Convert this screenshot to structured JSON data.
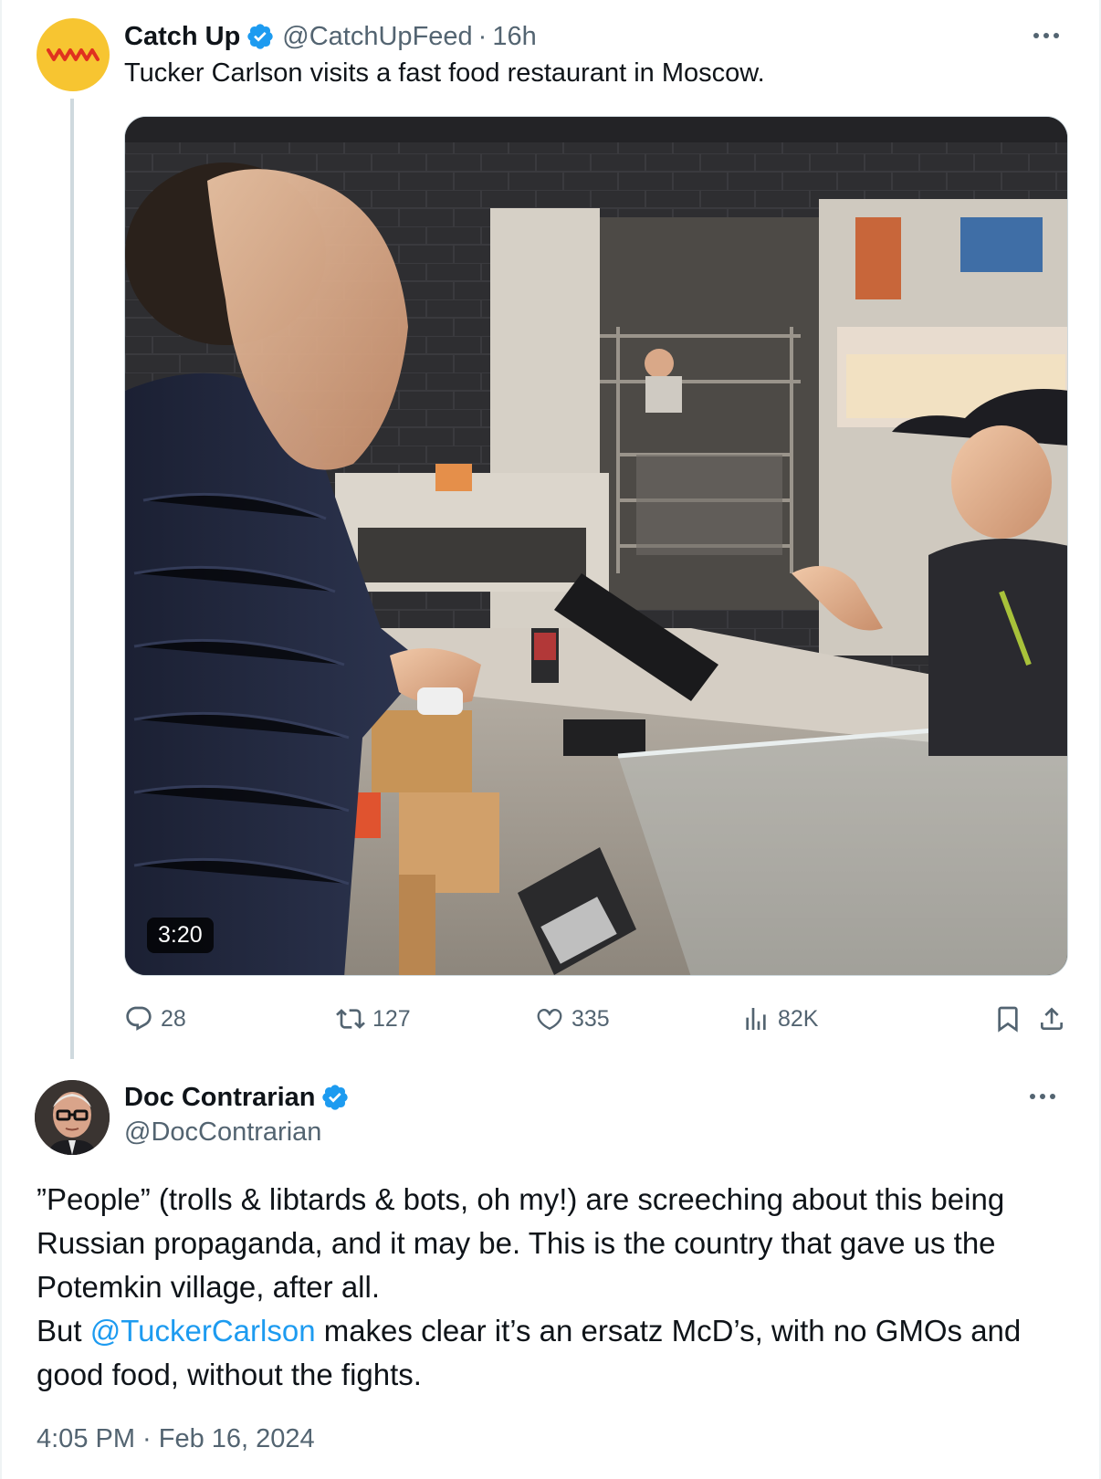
{
  "parent_tweet": {
    "author_name": "Catch Up",
    "handle": "@CatchUpFeed",
    "separator": "·",
    "age": "16h",
    "text": "Tucker Carlson visits a fast food restaurant in Moscow.",
    "video": {
      "duration": "3:20"
    },
    "stats": {
      "replies": "28",
      "reposts": "127",
      "likes": "335",
      "views": "82K"
    }
  },
  "main_tweet": {
    "author_name": "Doc Contrarian",
    "handle": "@DocContrarian",
    "lines": [
      "”People” (trolls & libtards & bots, oh my!) are screeching about this being",
      "Russian propaganda, and it may be. This is the country that gave us the",
      "Potemkin village, after all."
    ],
    "line4_pre": "But ",
    "mention": "@TuckerCarlson",
    "line4_post": " makes clear it’s an ersatz McD’s, with no GMOs and",
    "line5": "good food, without the fights.",
    "timestamp": "4:05 PM · Feb 16, 2024"
  },
  "colors": {
    "verified": "#1d9bf0",
    "link": "#1d9bf0",
    "muted_text": "#536471",
    "avatar_catchup_bg": "#f7c531",
    "avatar_catchup_logo": "#e0321f"
  },
  "icons": [
    "verified-badge-icon",
    "more-icon",
    "reply-icon",
    "repost-icon",
    "like-icon",
    "views-icon",
    "bookmark-icon",
    "share-icon"
  ]
}
